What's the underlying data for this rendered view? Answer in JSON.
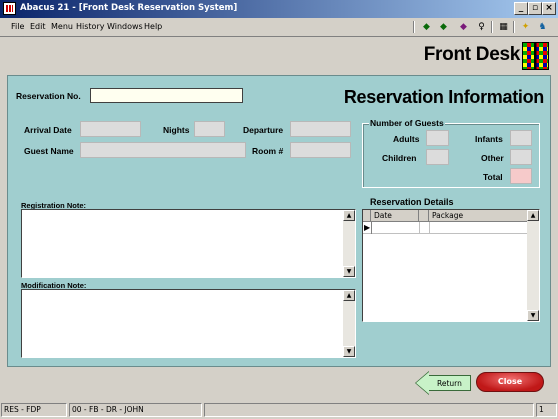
{
  "window": {
    "title": "Abacus 21 - [Front Desk Reservation System]"
  },
  "menu": [
    "File",
    "Edit",
    "Menu",
    "History",
    "Windows",
    "Help"
  ],
  "toolbar": {
    "icons": [
      "arrow-left-icon",
      "arrow-right-icon",
      "book-icon",
      "person-icon",
      "calculator-icon",
      "runner-icon",
      "key-person-icon"
    ]
  },
  "header": {
    "title": "Front Desk"
  },
  "form": {
    "reservation_no_label": "Reservation No.",
    "section_title": "Reservation Information",
    "arrival_date_label": "Arrival Date",
    "nights_label": "Nights",
    "departure_label": "Departure",
    "guest_name_label": "Guest Name",
    "room_label": "Room #",
    "reservation_no": "",
    "arrival_date": "",
    "nights": "",
    "departure": "",
    "guest_name": "",
    "room": ""
  },
  "guests": {
    "group_title": "Number of Guests",
    "adults_label": "Adults",
    "infants_label": "Infants",
    "children_label": "Children",
    "other_label": "Other",
    "total_label": "Total"
  },
  "notes": {
    "registration_label": "Registration Note:",
    "modification_label": "Modification Note:"
  },
  "details": {
    "title": "Reservation Details",
    "columns": [
      "Date",
      "Package"
    ],
    "rows": []
  },
  "buttons": {
    "return_label": "Return",
    "close_label": "Close"
  },
  "status": {
    "pane1": "RES - FDP",
    "pane2": "00 - FB - DR - JOHN",
    "pane3": "",
    "pane4": "1"
  },
  "colors": {
    "panel_bg": "#a0cecf",
    "close_button": "#d02020",
    "return_button": "#c8f2c8",
    "total_field": "#f6caca"
  }
}
